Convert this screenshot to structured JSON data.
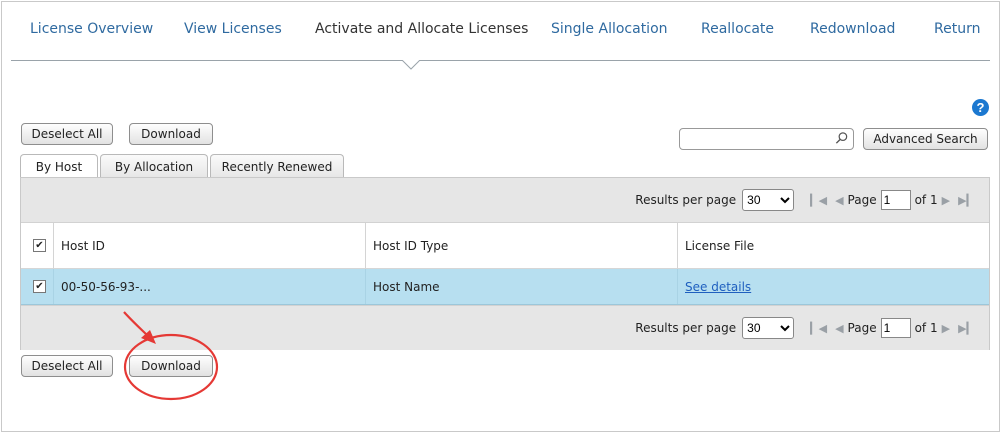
{
  "nav": {
    "tabs": [
      {
        "label": "License Overview"
      },
      {
        "label": "View Licenses"
      },
      {
        "label": "Activate and Allocate Licenses"
      },
      {
        "label": "Single Allocation"
      },
      {
        "label": "Reallocate"
      },
      {
        "label": "Redownload"
      },
      {
        "label": "Return"
      }
    ]
  },
  "actions": {
    "deselect_all": "Deselect All",
    "download": "Download"
  },
  "search": {
    "value": "",
    "advanced": "Advanced Search"
  },
  "view_tabs": [
    {
      "label": "By Host"
    },
    {
      "label": "By Allocation"
    },
    {
      "label": "Recently Renewed"
    }
  ],
  "pager": {
    "results_label": "Results per page",
    "per_page": "30",
    "page_label": "Page",
    "page": "1",
    "of_label": "of 1"
  },
  "table": {
    "columns": [
      "Host ID",
      "Host ID Type",
      "License File"
    ],
    "rows": [
      {
        "host_id": "00-50-56-93-...",
        "host_id_type": "Host Name",
        "license_file": "See details"
      }
    ]
  },
  "icons": {
    "help": "?"
  },
  "colors": {
    "accent": "#2f6aa0",
    "row_selected": "#b7dff0",
    "annotation": "#e53935"
  }
}
